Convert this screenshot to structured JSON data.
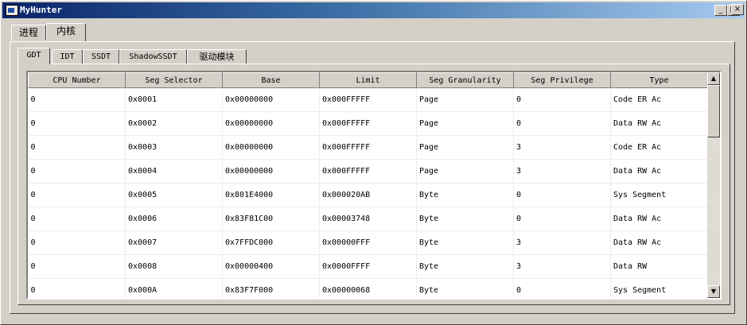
{
  "window": {
    "title": "MyHunter",
    "icon": "app-window-icon",
    "minimize_glyph": "_",
    "maximize_glyph": "□",
    "close_glyph": "×"
  },
  "outer_tabs": [
    {
      "label": "进程",
      "active": false
    },
    {
      "label": "内核",
      "active": true
    }
  ],
  "inner_tabs": [
    {
      "label": "GDT",
      "active": true
    },
    {
      "label": "IDT",
      "active": false
    },
    {
      "label": "SSDT",
      "active": false
    },
    {
      "label": "ShadowSSDT",
      "active": false
    },
    {
      "label": "驱动模块",
      "active": false
    }
  ],
  "table": {
    "columns": [
      "CPU Number",
      "Seg Selector",
      "Base",
      "Limit",
      "Seg Granularity",
      "Seg Privilege",
      "Type"
    ],
    "rows": [
      [
        "0",
        "0x0001",
        "0x00000000",
        "0x000FFFFF",
        "Page",
        "0",
        "Code ER Ac"
      ],
      [
        "0",
        "0x0002",
        "0x00000000",
        "0x000FFFFF",
        "Page",
        "0",
        "Data RW Ac"
      ],
      [
        "0",
        "0x0003",
        "0x00000000",
        "0x000FFFFF",
        "Page",
        "3",
        "Code ER Ac"
      ],
      [
        "0",
        "0x0004",
        "0x00000000",
        "0x000FFFFF",
        "Page",
        "3",
        "Data RW Ac"
      ],
      [
        "0",
        "0x0005",
        "0x801E4000",
        "0x000020AB",
        "Byte",
        "0",
        "Sys Segment"
      ],
      [
        "0",
        "0x0006",
        "0x83F81C00",
        "0x00003748",
        "Byte",
        "0",
        "Data RW Ac"
      ],
      [
        "0",
        "0x0007",
        "0x7FFDC000",
        "0x00000FFF",
        "Byte",
        "3",
        "Data RW Ac"
      ],
      [
        "0",
        "0x0008",
        "0x00000400",
        "0x0000FFFF",
        "Byte",
        "3",
        "Data RW"
      ],
      [
        "0",
        "0x000A",
        "0x83F7F000",
        "0x00000068",
        "Byte",
        "0",
        "Sys Segment"
      ]
    ]
  },
  "scrollbar": {
    "up_glyph": "▲",
    "down_glyph": "▼"
  }
}
